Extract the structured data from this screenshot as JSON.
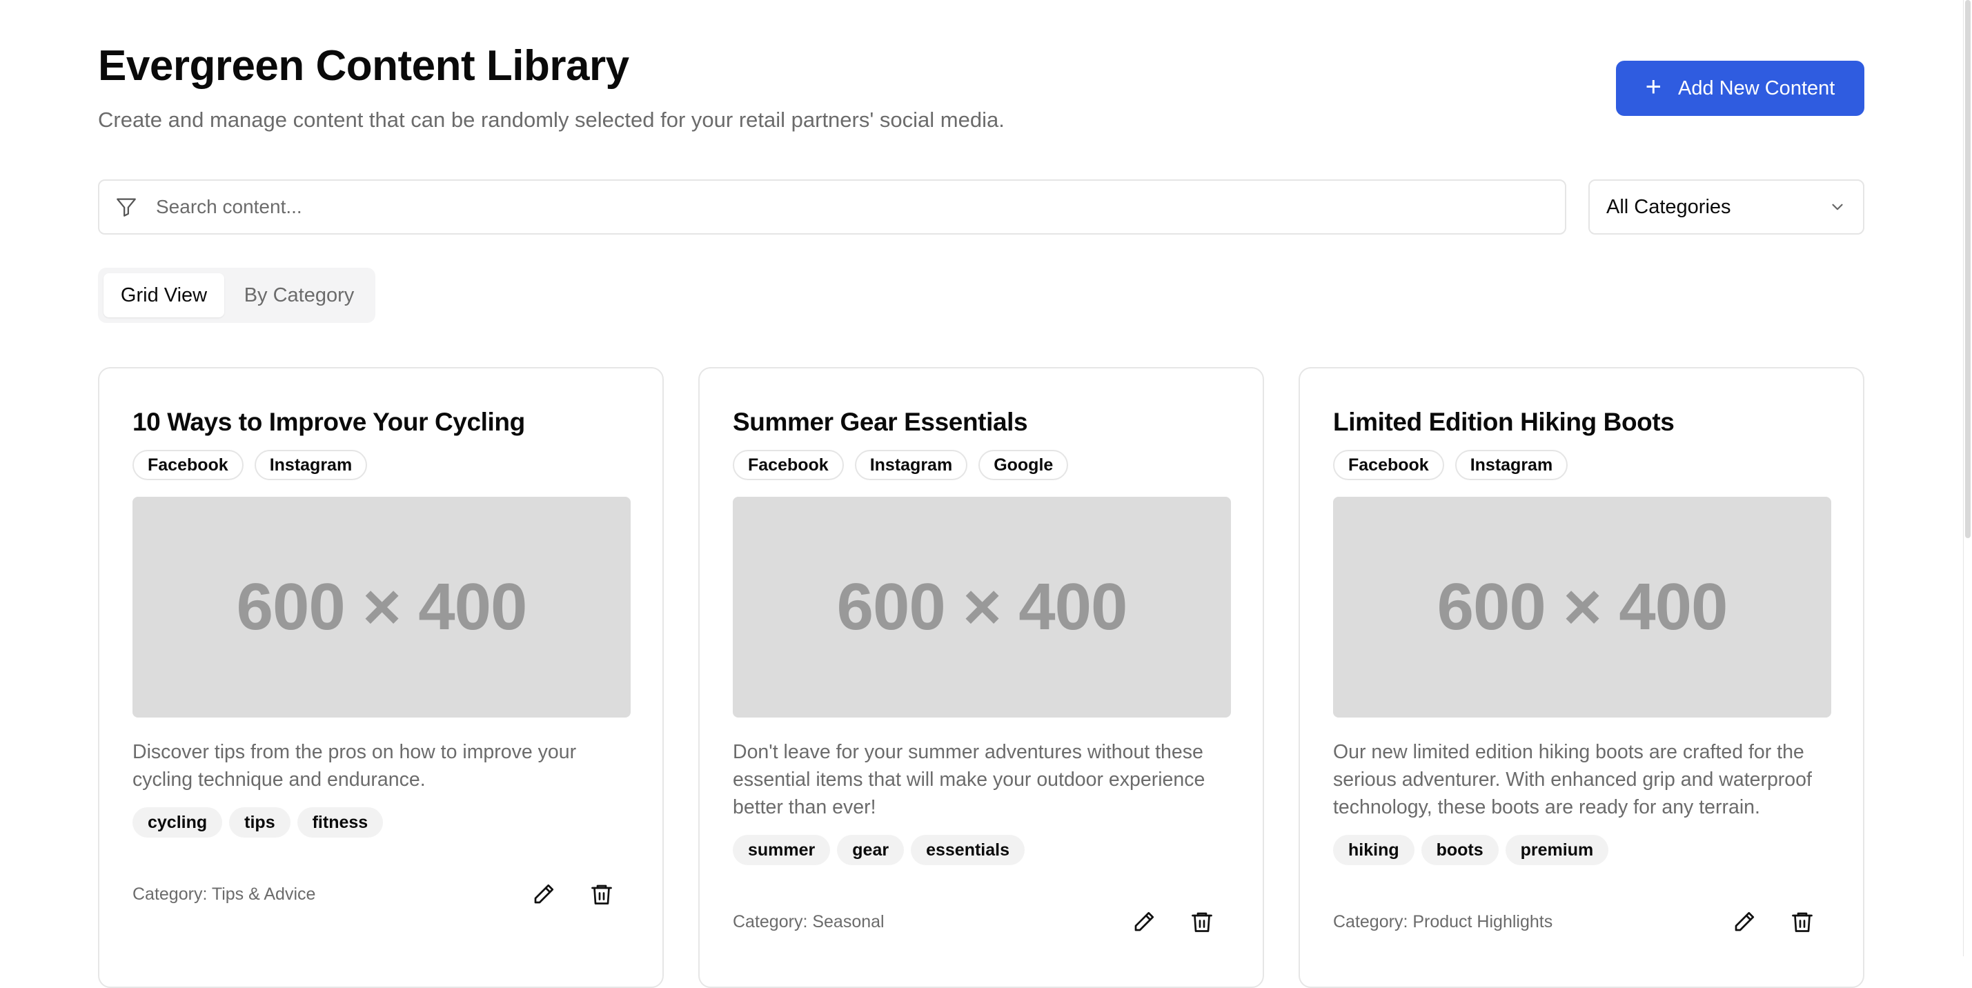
{
  "header": {
    "title": "Evergreen Content Library",
    "subtitle": "Create and manage content that can be randomly selected for your retail partners' social media.",
    "add_button_label": "Add New Content",
    "add_button_icon": "plus-icon"
  },
  "search": {
    "placeholder": "Search content...",
    "value": "",
    "icon": "filter-icon"
  },
  "category_select": {
    "selected": "All Categories",
    "icon": "chevron-down-icon"
  },
  "view_tabs": [
    {
      "label": "Grid View",
      "active": true
    },
    {
      "label": "By Category",
      "active": false
    }
  ],
  "cards": [
    {
      "title": "10 Ways to Improve Your Cycling",
      "platforms": [
        "Facebook",
        "Instagram"
      ],
      "image_placeholder": "600 × 400",
      "description": "Discover tips from the pros on how to improve your cycling technique and endurance.",
      "tags": [
        "cycling",
        "tips",
        "fitness"
      ],
      "category": "Category: Tips & Advice"
    },
    {
      "title": "Summer Gear Essentials",
      "platforms": [
        "Facebook",
        "Instagram",
        "Google"
      ],
      "image_placeholder": "600 × 400",
      "description": "Don't leave for your summer adventures without these essential items that will make your outdoor experience better than ever!",
      "tags": [
        "summer",
        "gear",
        "essentials"
      ],
      "category": "Category: Seasonal"
    },
    {
      "title": "Limited Edition Hiking Boots",
      "platforms": [
        "Facebook",
        "Instagram"
      ],
      "image_placeholder": "600 × 400",
      "description": "Our new limited edition hiking boots are crafted for the serious adventurer. With enhanced grip and waterproof technology, these boots are ready for any terrain.",
      "tags": [
        "hiking",
        "boots",
        "premium"
      ],
      "category": "Category: Product Highlights"
    }
  ],
  "card_actions": {
    "edit_icon": "pencil-icon",
    "delete_icon": "trash-icon"
  },
  "colors": {
    "accent": "#2f5ce0",
    "muted_text": "#6b6b6b",
    "border": "#e5e5e5",
    "image_bg": "#dcdcdc"
  }
}
